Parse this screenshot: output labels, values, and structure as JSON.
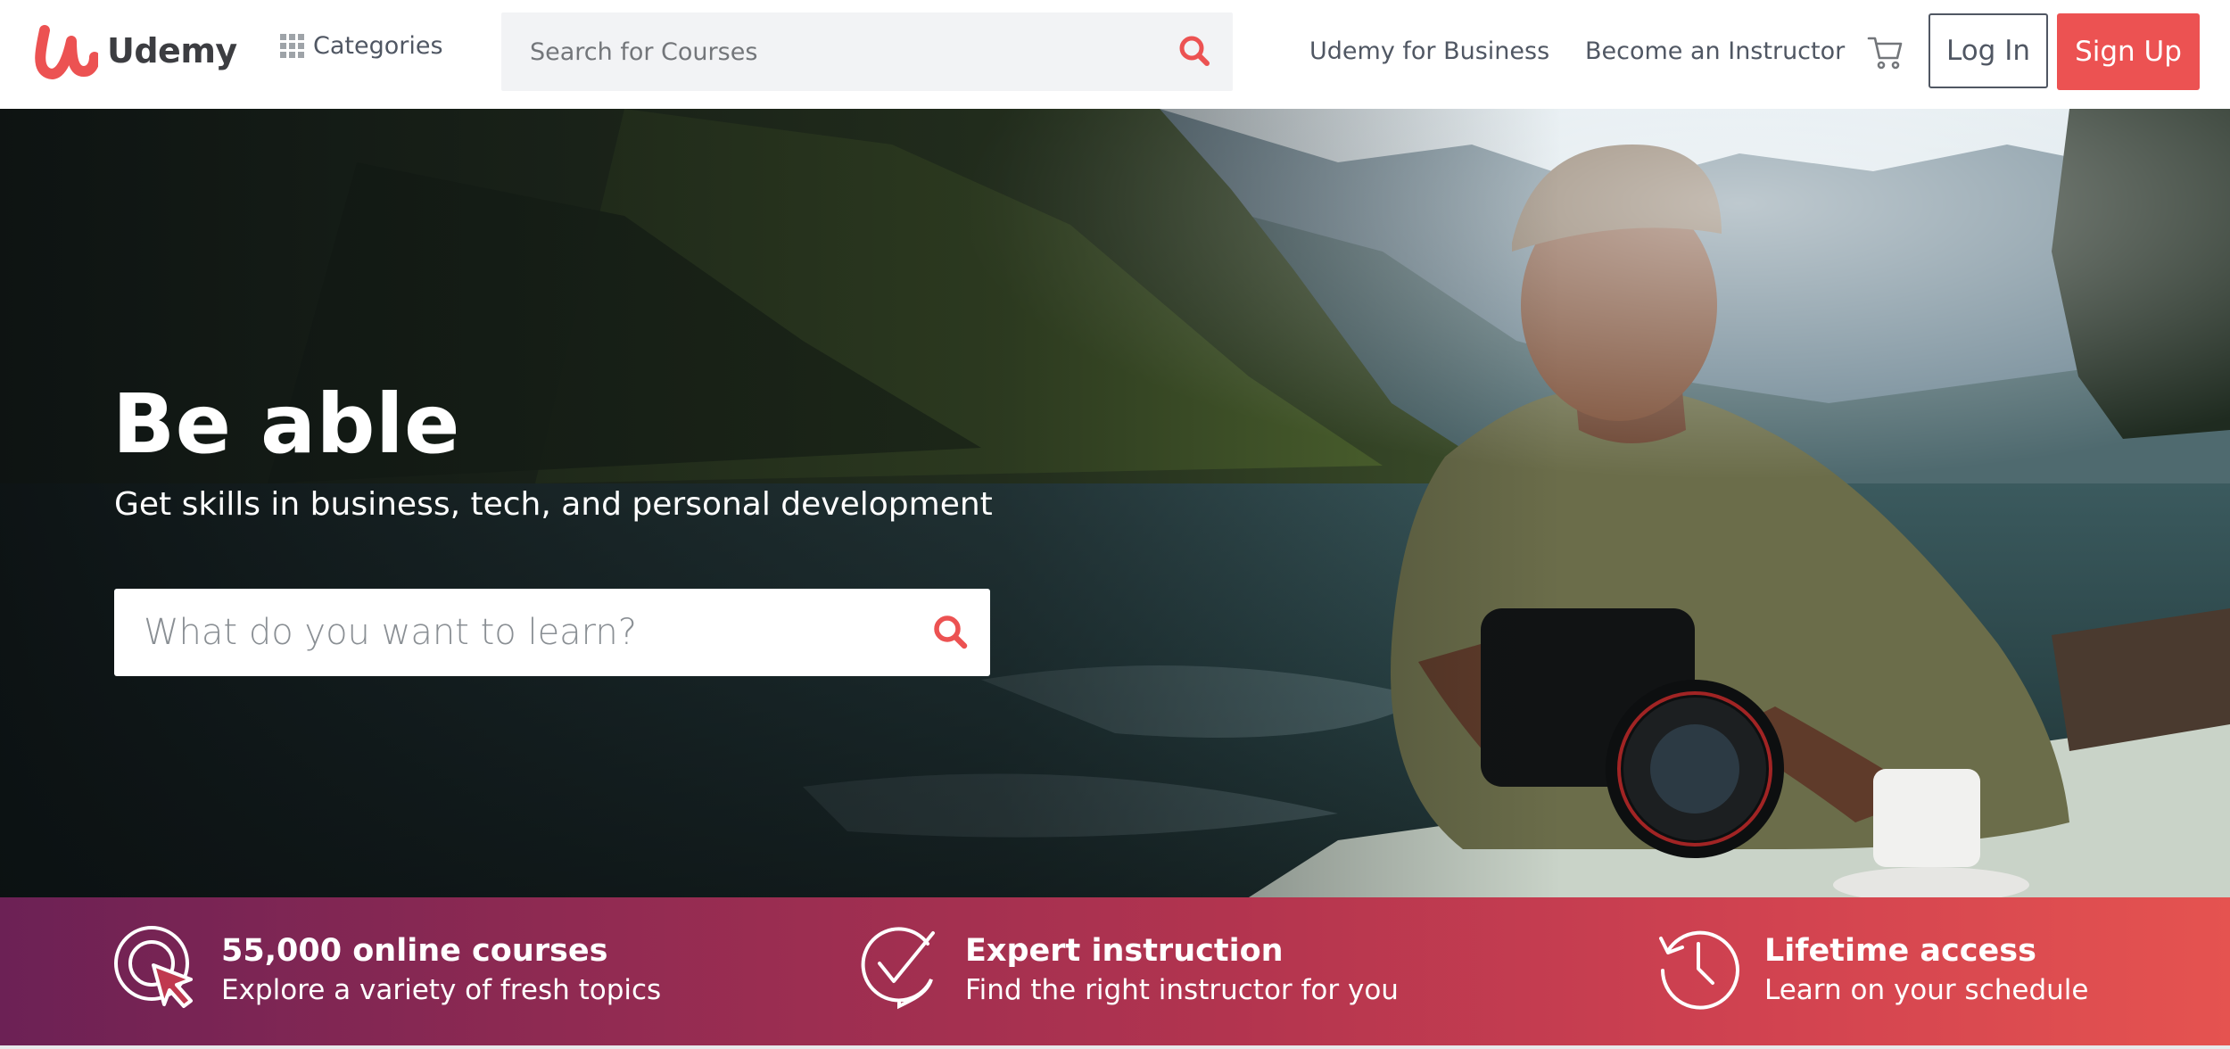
{
  "header": {
    "logo_text": "Udemy",
    "categories_label": "Categories",
    "search_placeholder": "Search for Courses",
    "business_link": "Udemy for Business",
    "instructor_link": "Become an Instructor",
    "login_label": "Log In",
    "signup_label": "Sign Up"
  },
  "hero": {
    "title": "Be able",
    "subtitle": "Get skills in business, tech, and personal development",
    "search_placeholder": "What do you want to learn?"
  },
  "value_props": [
    {
      "icon": "cursor-click-icon",
      "title": "55,000 online courses",
      "description": "Explore a variety of fresh topics"
    },
    {
      "icon": "check-badge-icon",
      "title": "Expert instruction",
      "description": "Find the right instructor for you"
    },
    {
      "icon": "clock-history-icon",
      "title": "Lifetime access",
      "description": "Learn on your schedule"
    }
  ],
  "colors": {
    "brand": "#ec5252",
    "text": "#505763",
    "strip_start": "#6c2155",
    "strip_end": "#e55350"
  }
}
